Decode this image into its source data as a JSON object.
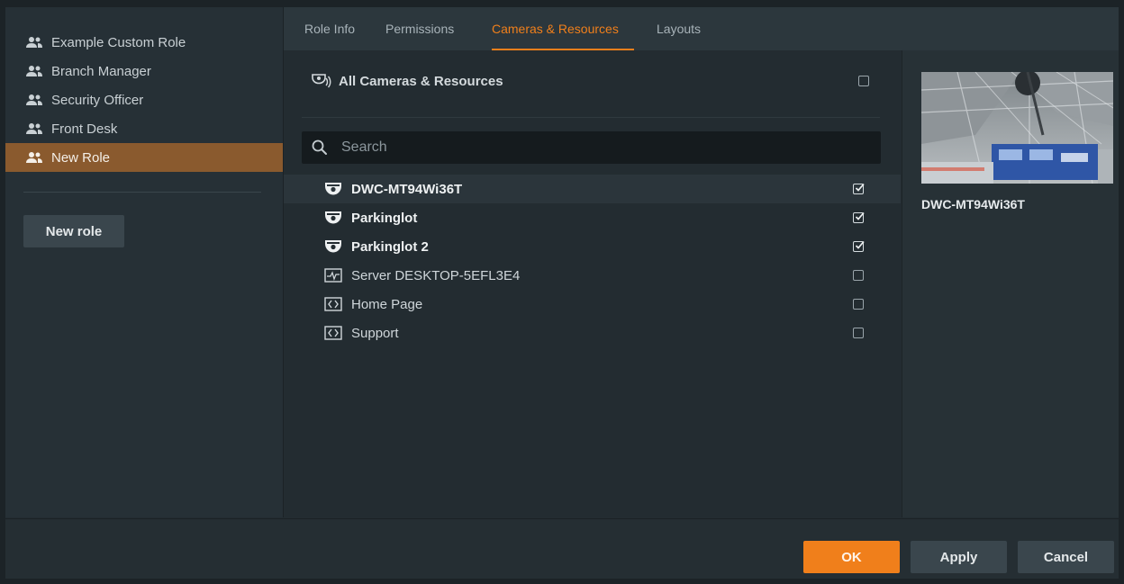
{
  "roles": {
    "items": [
      {
        "label": "Example Custom Role",
        "icon": "users-icon"
      },
      {
        "label": "Branch Manager",
        "icon": "users-icon"
      },
      {
        "label": "Security Officer",
        "icon": "users-icon"
      },
      {
        "label": "Front Desk",
        "icon": "users-icon"
      },
      {
        "label": "New Role",
        "icon": "users-icon",
        "active": true
      }
    ],
    "new_role_label": "New role"
  },
  "tabs": [
    {
      "label": "Role Info"
    },
    {
      "label": "Permissions"
    },
    {
      "label": "Cameras & Resources",
      "active": true
    },
    {
      "label": "Layouts"
    }
  ],
  "resources": {
    "all_label": "All Cameras & Resources",
    "all_checked": false,
    "search_placeholder": "Search",
    "items": [
      {
        "label": "DWC-MT94Wi36T",
        "icon": "camera-icon",
        "checked": true,
        "selected": true
      },
      {
        "label": "Parkinglot",
        "icon": "camera-icon",
        "checked": true
      },
      {
        "label": "Parkinglot 2",
        "icon": "camera-icon",
        "checked": true
      },
      {
        "label": "Server DESKTOP-5EFL3E4",
        "icon": "server-icon",
        "checked": false
      },
      {
        "label": "Home Page",
        "icon": "web-page-icon",
        "checked": false
      },
      {
        "label": "Support",
        "icon": "web-page-icon",
        "checked": false
      }
    ]
  },
  "preview": {
    "name": "DWC-MT94Wi36T"
  },
  "footer": {
    "ok_label": "OK",
    "apply_label": "Apply",
    "cancel_label": "Cancel"
  },
  "colors": {
    "accent": "#f07f1b",
    "active_role_bg": "#8a5a2e"
  }
}
